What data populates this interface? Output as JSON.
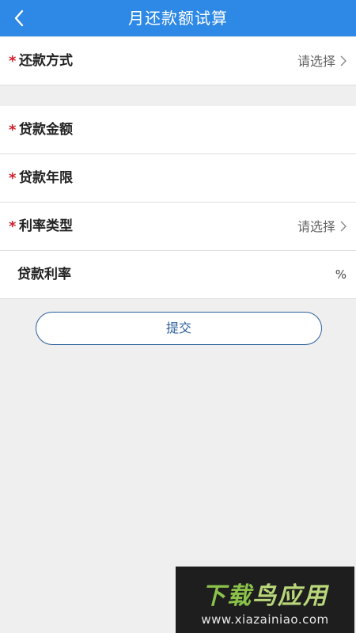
{
  "header": {
    "title": "月还款额试算",
    "back_icon": "chevron-left-icon"
  },
  "form": {
    "repayment_method": {
      "required_mark": "*",
      "label": "还款方式",
      "value": "请选择"
    },
    "loan_amount": {
      "required_mark": "*",
      "label": "贷款金额",
      "value": ""
    },
    "loan_term": {
      "required_mark": "*",
      "label": "贷款年限",
      "value": ""
    },
    "rate_type": {
      "required_mark": "*",
      "label": "利率类型",
      "value": "请选择"
    },
    "loan_rate": {
      "label": "贷款利率",
      "unit": "%",
      "value": ""
    }
  },
  "submit_label": "提交",
  "watermark": {
    "title_part1": "下载",
    "title_part2": "鸟应用",
    "url": "www.xiazainiao.com"
  },
  "colors": {
    "header_bg": "#2e88e6",
    "required": "#d0202a",
    "button_border": "#2a5f9a",
    "page_bg": "#efefef"
  }
}
